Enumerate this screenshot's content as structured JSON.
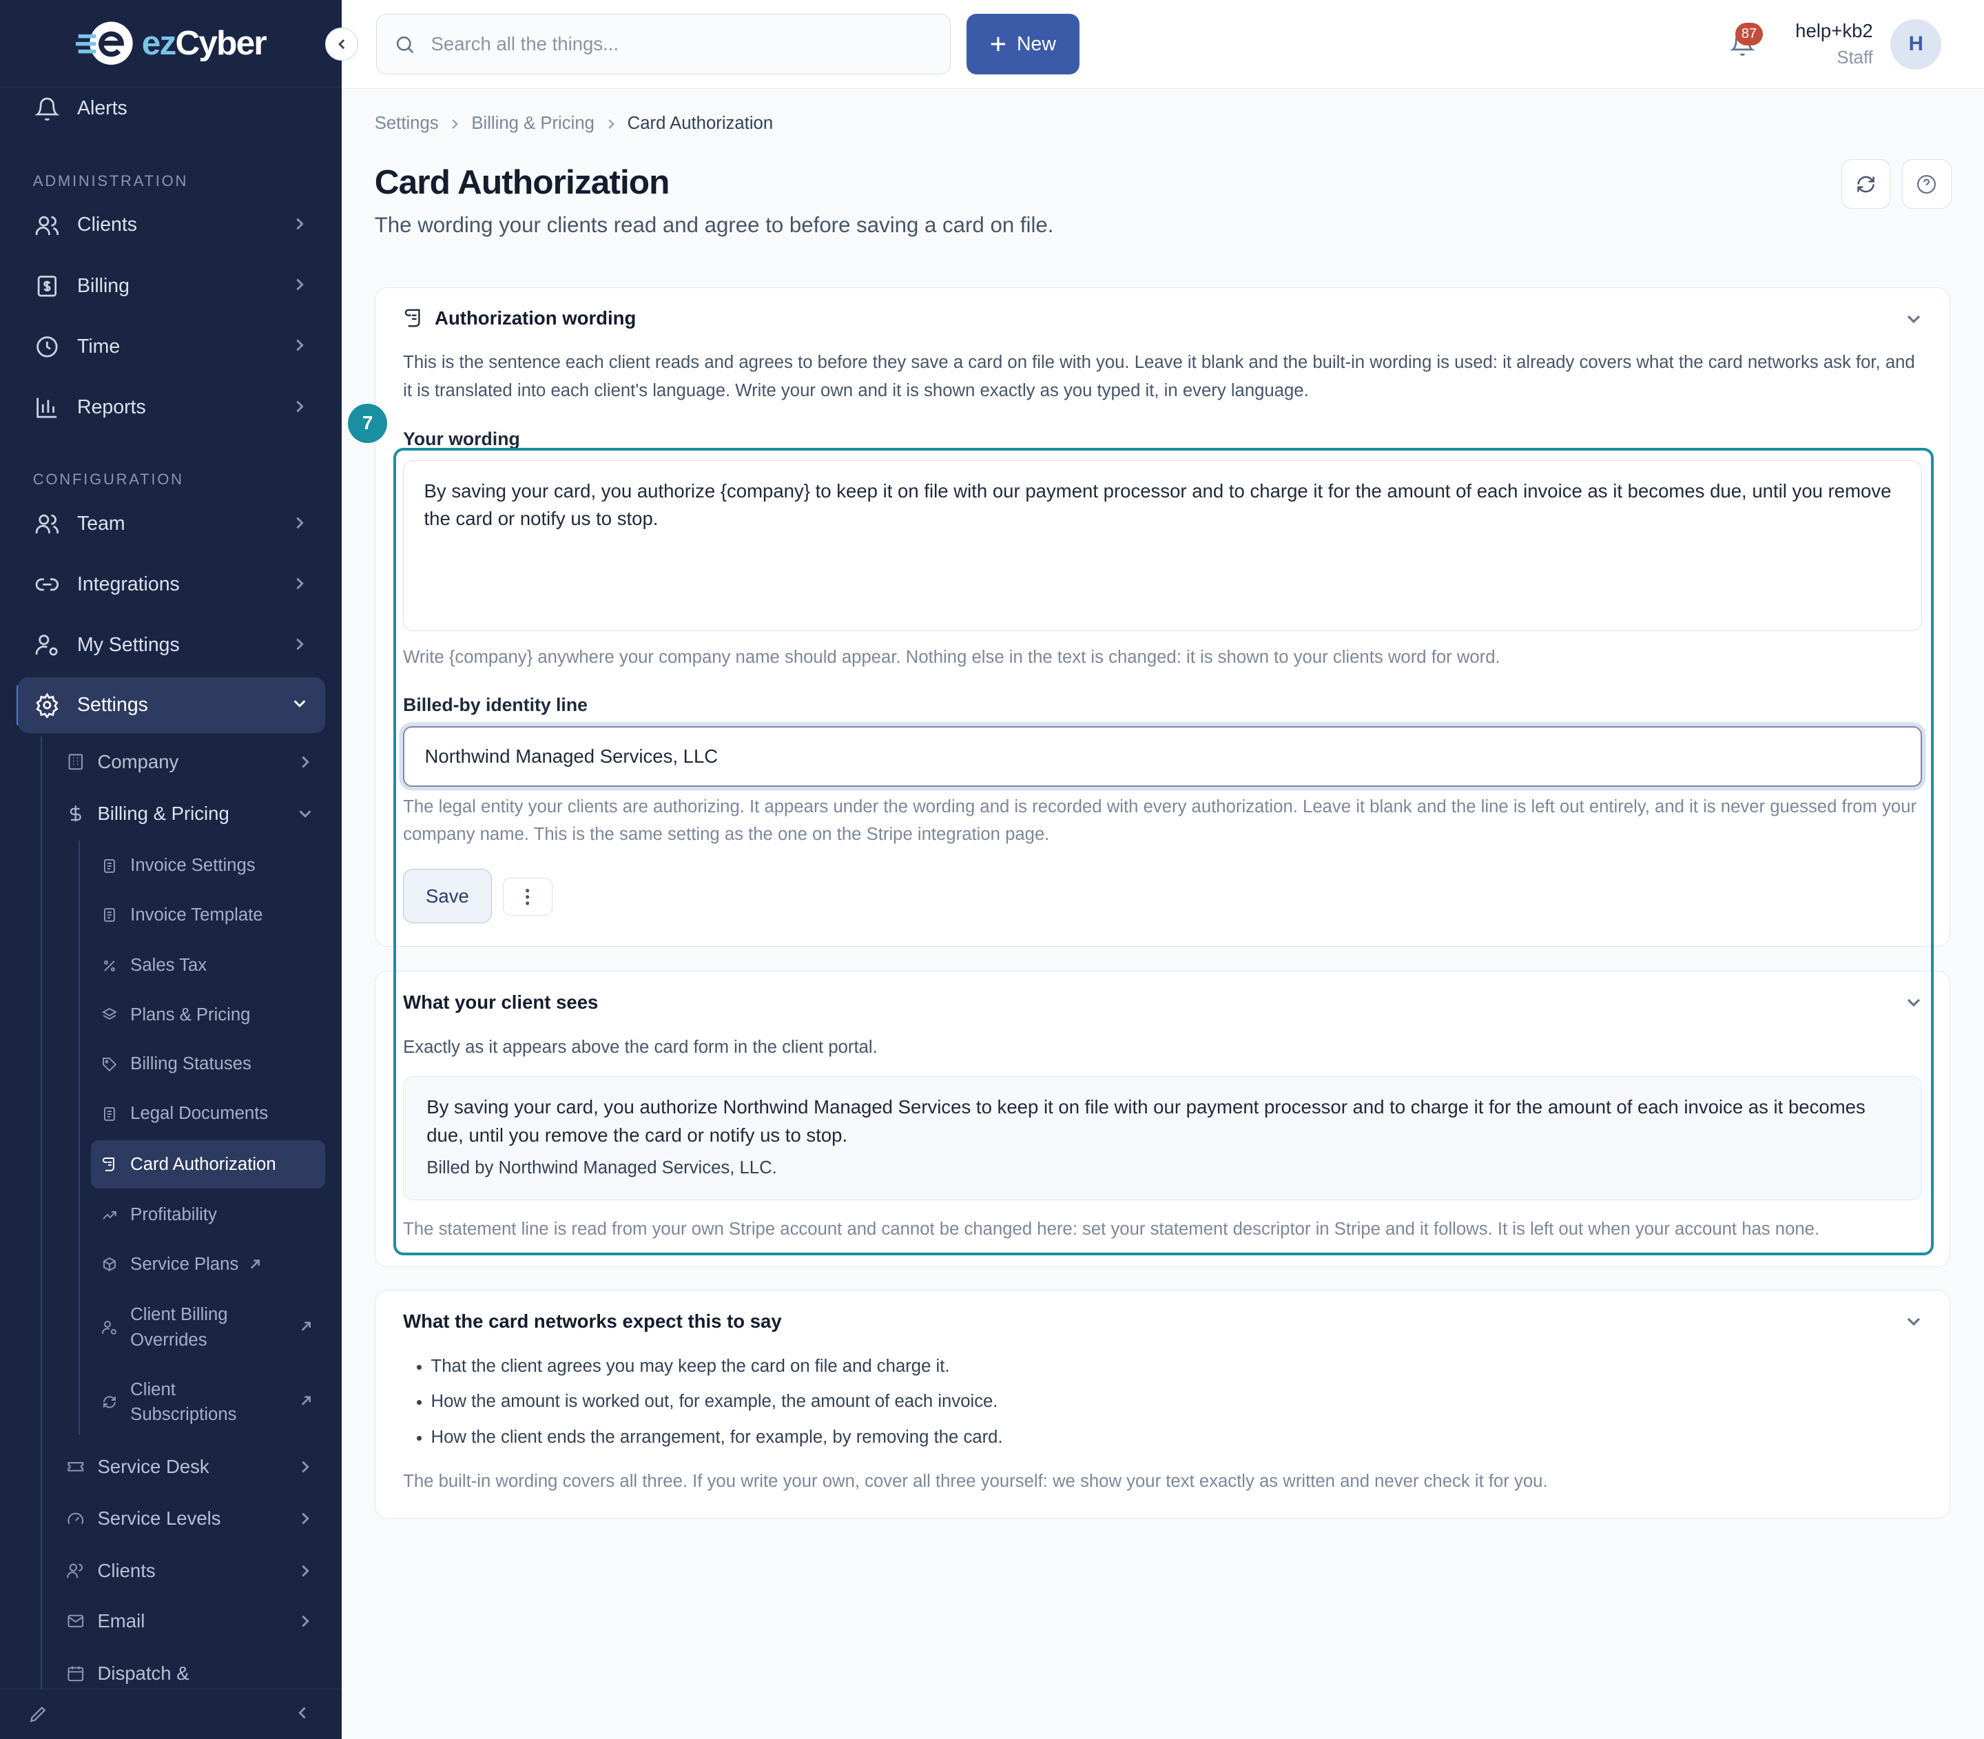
{
  "app": {
    "logo_text_a": "ez",
    "logo_text_b": "Cyber",
    "brand_color": "#3b5ba9",
    "sidebar_color": "#1a2544",
    "highlight_color": "#1a8fa1"
  },
  "topbar": {
    "search_placeholder": "Search all the things...",
    "new_label": "New",
    "notification_count": "87",
    "user_name": "help+kb2",
    "user_role": "Staff",
    "avatar_initial": "H"
  },
  "sidebar": {
    "alerts": "Alerts",
    "section_admin": "ADMINISTRATION",
    "clients": "Clients",
    "billing": "Billing",
    "time": "Time",
    "reports": "Reports",
    "section_config": "CONFIGURATION",
    "team": "Team",
    "integrations": "Integrations",
    "my_settings": "My Settings",
    "settings": "Settings",
    "settings_children": {
      "company": "Company",
      "billing_pricing": "Billing & Pricing",
      "service_desk": "Service Desk",
      "service_levels": "Service Levels",
      "clients": "Clients",
      "email": "Email",
      "dispatch": "Dispatch &"
    },
    "billing_children": [
      {
        "label": "Invoice Settings",
        "icon": "document-icon"
      },
      {
        "label": "Invoice Template",
        "icon": "document-icon"
      },
      {
        "label": "Sales Tax",
        "icon": "percent-icon"
      },
      {
        "label": "Plans & Pricing",
        "icon": "layers-icon"
      },
      {
        "label": "Billing Statuses",
        "icon": "tag-icon"
      },
      {
        "label": "Legal Documents",
        "icon": "document-icon"
      },
      {
        "label": "Card Authorization",
        "icon": "scroll-icon"
      },
      {
        "label": "Profitability",
        "icon": "trend-icon"
      },
      {
        "label": "Service Plans",
        "icon": "box-icon"
      },
      {
        "label": "Client Billing Overrides",
        "icon": "user-gear-icon"
      },
      {
        "label": "Client Subscriptions",
        "icon": "refresh-icon"
      }
    ]
  },
  "breadcrumb": {
    "items": [
      "Settings",
      "Billing & Pricing"
    ],
    "current": "Card Authorization"
  },
  "page": {
    "title": "Card Authorization",
    "subtitle": "The wording your clients read and agree to before saving a card on file."
  },
  "auth_card": {
    "title": "Authorization wording",
    "description": "This is the sentence each client reads and agrees to before they save a card on file with you. Leave it blank and the built-in wording is used: it already covers what the card networks ask for, and it is translated into each client's language. Write your own and it is shown exactly as you typed it, in every language.",
    "wording_label": "Your wording",
    "wording_value": "By saving your card, you authorize {company} to keep it on file with our payment processor and to charge it for the amount of each invoice as it becomes due, until you remove the card or notify us to stop.",
    "wording_hint": "Write {company} anywhere your company name should appear. Nothing else in the text is changed: it is shown to your clients word for word.",
    "billed_label": "Billed-by identity line",
    "billed_value": "Northwind Managed Services, LLC",
    "billed_hint": "The legal entity your clients are authorizing. It appears under the wording and is recorded with every authorization. Leave it blank and the line is left out entirely, and it is never guessed from your company name. This is the same setting as the one on the Stripe integration page.",
    "save_label": "Save"
  },
  "preview_card": {
    "title": "What your client sees",
    "description": "Exactly as it appears above the card form in the client portal.",
    "preview_text": "By saving your card, you authorize Northwind Managed Services to keep it on file with our payment processor and to charge it for the amount of each invoice as it becomes due, until you remove the card or notify us to stop.",
    "billed_line": "Billed by Northwind Managed Services, LLC.",
    "footnote": "The statement line is read from your own Stripe account and cannot be changed here: set your statement descriptor in Stripe and it follows. It is left out when your account has none."
  },
  "networks_card": {
    "title": "What the card networks expect this to say",
    "bullets": [
      "That the client agrees you may keep the card on file and charge it.",
      "How the amount is worked out, for example, the amount of each invoice.",
      "How the client ends the arrangement, for example, by removing the card."
    ],
    "footnote": "The built-in wording covers all three. If you write your own, cover all three yourself: we show your text exactly as written and never check it for you."
  },
  "annotation": {
    "step_number": "7"
  }
}
